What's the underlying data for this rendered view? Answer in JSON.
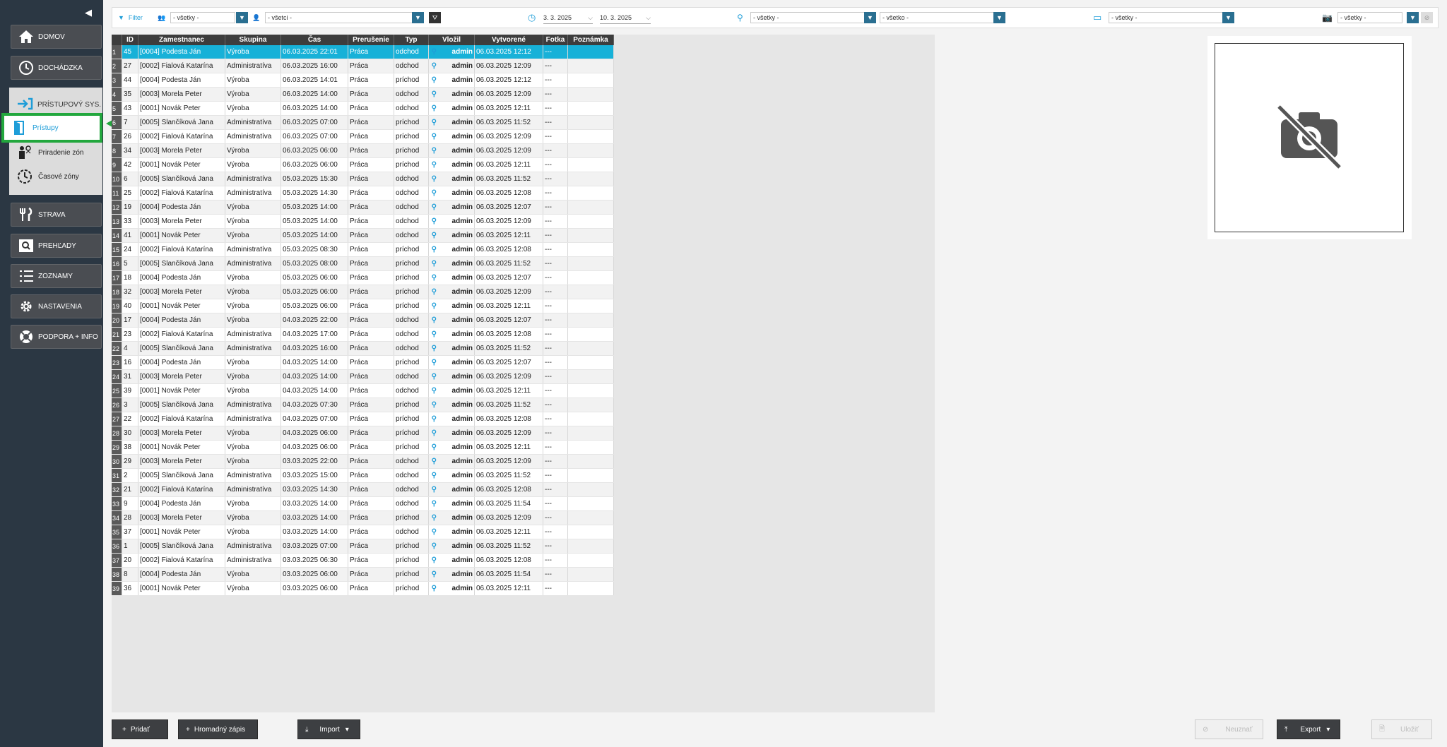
{
  "sidebar": {
    "collapse_icon": "triangle-left",
    "nav": [
      {
        "id": "domov",
        "label": "DOMOV",
        "icon": "home-icon"
      },
      {
        "id": "dochadzka",
        "label": "DOCHÁDZKA",
        "icon": "clock-icon"
      },
      {
        "id": "strava",
        "label": "STRAVA",
        "icon": "cutlery-icon"
      },
      {
        "id": "prehlady",
        "label": "PREHĽADY",
        "icon": "search-icon"
      },
      {
        "id": "zoznamy",
        "label": "ZOZNAMY",
        "icon": "list-icon"
      },
      {
        "id": "nastavenia",
        "label": "NASTAVENIA",
        "icon": "gear-icon"
      },
      {
        "id": "podpora",
        "label": "PODPORA + INFO",
        "icon": "lifebuoy-icon"
      }
    ],
    "access": {
      "label": "PRÍSTUPOVÝ SYS.",
      "items": [
        {
          "label": "Prístupy",
          "icon": "door-icon",
          "active": true
        },
        {
          "label": "Priradenie zón",
          "icon": "people-icon"
        },
        {
          "label": "Časové zóny",
          "icon": "clock-zone-icon"
        }
      ]
    }
  },
  "toolbar": {
    "filter_label": "Filter",
    "group_value": "- všetky -",
    "employee_value": "- všetci -",
    "date_from": "3. 3. 2025",
    "date_to": "10. 3. 2025",
    "location_value": "- všetky -",
    "location2_value": "- všetko -",
    "terminal_value": "- všetky -",
    "photo_value": "- všetky -"
  },
  "table": {
    "columns": [
      "ID",
      "Zamestnanec",
      "Skupina",
      "Čas",
      "Prerušenie",
      "Typ",
      "Vložil",
      "Vytvorené",
      "Fotka",
      "Poznámka"
    ],
    "rows": [
      [
        "45",
        "[0004] Podesta Ján",
        "Výroba",
        "06.03.2025 22:01",
        "Práca",
        "odchod",
        "admin",
        "06.03.2025 12:12",
        "---",
        ""
      ],
      [
        "27",
        "[0002] Fialová Katarína",
        "Administratíva",
        "06.03.2025 16:00",
        "Práca",
        "odchod",
        "admin",
        "06.03.2025 12:09",
        "---",
        ""
      ],
      [
        "44",
        "[0004] Podesta Ján",
        "Výroba",
        "06.03.2025 14:01",
        "Práca",
        "príchod",
        "admin",
        "06.03.2025 12:12",
        "---",
        ""
      ],
      [
        "35",
        "[0003] Morela Peter",
        "Výroba",
        "06.03.2025 14:00",
        "Práca",
        "odchod",
        "admin",
        "06.03.2025 12:09",
        "---",
        ""
      ],
      [
        "43",
        "[0001] Novák Peter",
        "Výroba",
        "06.03.2025 14:00",
        "Práca",
        "odchod",
        "admin",
        "06.03.2025 12:11",
        "---",
        ""
      ],
      [
        "7",
        "[0005] Slančíková Jana",
        "Administratíva",
        "06.03.2025 07:00",
        "Práca",
        "príchod",
        "admin",
        "06.03.2025 11:52",
        "---",
        ""
      ],
      [
        "26",
        "[0002] Fialová Katarína",
        "Administratíva",
        "06.03.2025 07:00",
        "Práca",
        "príchod",
        "admin",
        "06.03.2025 12:09",
        "---",
        ""
      ],
      [
        "34",
        "[0003] Morela Peter",
        "Výroba",
        "06.03.2025 06:00",
        "Práca",
        "príchod",
        "admin",
        "06.03.2025 12:09",
        "---",
        ""
      ],
      [
        "42",
        "[0001] Novák Peter",
        "Výroba",
        "06.03.2025 06:00",
        "Práca",
        "príchod",
        "admin",
        "06.03.2025 12:11",
        "---",
        ""
      ],
      [
        "6",
        "[0005] Slančíková Jana",
        "Administratíva",
        "05.03.2025 15:30",
        "Práca",
        "odchod",
        "admin",
        "06.03.2025 11:52",
        "---",
        ""
      ],
      [
        "25",
        "[0002] Fialová Katarína",
        "Administratíva",
        "05.03.2025 14:30",
        "Práca",
        "odchod",
        "admin",
        "06.03.2025 12:08",
        "---",
        ""
      ],
      [
        "19",
        "[0004] Podesta Ján",
        "Výroba",
        "05.03.2025 14:00",
        "Práca",
        "odchod",
        "admin",
        "06.03.2025 12:07",
        "---",
        ""
      ],
      [
        "33",
        "[0003] Morela Peter",
        "Výroba",
        "05.03.2025 14:00",
        "Práca",
        "odchod",
        "admin",
        "06.03.2025 12:09",
        "---",
        ""
      ],
      [
        "41",
        "[0001] Novák Peter",
        "Výroba",
        "05.03.2025 14:00",
        "Práca",
        "odchod",
        "admin",
        "06.03.2025 12:11",
        "---",
        ""
      ],
      [
        "24",
        "[0002] Fialová Katarína",
        "Administratíva",
        "05.03.2025 08:30",
        "Práca",
        "príchod",
        "admin",
        "06.03.2025 12:08",
        "---",
        ""
      ],
      [
        "5",
        "[0005] Slančíková Jana",
        "Administratíva",
        "05.03.2025 08:00",
        "Práca",
        "príchod",
        "admin",
        "06.03.2025 11:52",
        "---",
        ""
      ],
      [
        "18",
        "[0004] Podesta Ján",
        "Výroba",
        "05.03.2025 06:00",
        "Práca",
        "príchod",
        "admin",
        "06.03.2025 12:07",
        "---",
        ""
      ],
      [
        "32",
        "[0003] Morela Peter",
        "Výroba",
        "05.03.2025 06:00",
        "Práca",
        "príchod",
        "admin",
        "06.03.2025 12:09",
        "---",
        ""
      ],
      [
        "40",
        "[0001] Novák Peter",
        "Výroba",
        "05.03.2025 06:00",
        "Práca",
        "príchod",
        "admin",
        "06.03.2025 12:11",
        "---",
        ""
      ],
      [
        "17",
        "[0004] Podesta Ján",
        "Výroba",
        "04.03.2025 22:00",
        "Práca",
        "odchod",
        "admin",
        "06.03.2025 12:07",
        "---",
        ""
      ],
      [
        "23",
        "[0002] Fialová Katarína",
        "Administratíva",
        "04.03.2025 17:00",
        "Práca",
        "odchod",
        "admin",
        "06.03.2025 12:08",
        "---",
        ""
      ],
      [
        "4",
        "[0005] Slančíková Jana",
        "Administratíva",
        "04.03.2025 16:00",
        "Práca",
        "odchod",
        "admin",
        "06.03.2025 11:52",
        "---",
        ""
      ],
      [
        "16",
        "[0004] Podesta Ján",
        "Výroba",
        "04.03.2025 14:00",
        "Práca",
        "príchod",
        "admin",
        "06.03.2025 12:07",
        "---",
        ""
      ],
      [
        "31",
        "[0003] Morela Peter",
        "Výroba",
        "04.03.2025 14:00",
        "Práca",
        "odchod",
        "admin",
        "06.03.2025 12:09",
        "---",
        ""
      ],
      [
        "39",
        "[0001] Novák Peter",
        "Výroba",
        "04.03.2025 14:00",
        "Práca",
        "odchod",
        "admin",
        "06.03.2025 12:11",
        "---",
        ""
      ],
      [
        "3",
        "[0005] Slančíková Jana",
        "Administratíva",
        "04.03.2025 07:30",
        "Práca",
        "príchod",
        "admin",
        "06.03.2025 11:52",
        "---",
        ""
      ],
      [
        "22",
        "[0002] Fialová Katarína",
        "Administratíva",
        "04.03.2025 07:00",
        "Práca",
        "príchod",
        "admin",
        "06.03.2025 12:08",
        "---",
        ""
      ],
      [
        "30",
        "[0003] Morela Peter",
        "Výroba",
        "04.03.2025 06:00",
        "Práca",
        "príchod",
        "admin",
        "06.03.2025 12:09",
        "---",
        ""
      ],
      [
        "38",
        "[0001] Novák Peter",
        "Výroba",
        "04.03.2025 06:00",
        "Práca",
        "príchod",
        "admin",
        "06.03.2025 12:11",
        "---",
        ""
      ],
      [
        "29",
        "[0003] Morela Peter",
        "Výroba",
        "03.03.2025 22:00",
        "Práca",
        "odchod",
        "admin",
        "06.03.2025 12:09",
        "---",
        ""
      ],
      [
        "2",
        "[0005] Slančíková Jana",
        "Administratíva",
        "03.03.2025 15:00",
        "Práca",
        "odchod",
        "admin",
        "06.03.2025 11:52",
        "---",
        ""
      ],
      [
        "21",
        "[0002] Fialová Katarína",
        "Administratíva",
        "03.03.2025 14:30",
        "Práca",
        "odchod",
        "admin",
        "06.03.2025 12:08",
        "---",
        ""
      ],
      [
        "9",
        "[0004] Podesta Ján",
        "Výroba",
        "03.03.2025 14:00",
        "Práca",
        "odchod",
        "admin",
        "06.03.2025 11:54",
        "---",
        ""
      ],
      [
        "28",
        "[0003] Morela Peter",
        "Výroba",
        "03.03.2025 14:00",
        "Práca",
        "príchod",
        "admin",
        "06.03.2025 12:09",
        "---",
        ""
      ],
      [
        "37",
        "[0001] Novák Peter",
        "Výroba",
        "03.03.2025 14:00",
        "Práca",
        "odchod",
        "admin",
        "06.03.2025 12:11",
        "---",
        ""
      ],
      [
        "1",
        "[0005] Slančíková Jana",
        "Administratíva",
        "03.03.2025 07:00",
        "Práca",
        "príchod",
        "admin",
        "06.03.2025 11:52",
        "---",
        ""
      ],
      [
        "20",
        "[0002] Fialová Katarína",
        "Administratíva",
        "03.03.2025 06:30",
        "Práca",
        "príchod",
        "admin",
        "06.03.2025 12:08",
        "---",
        ""
      ],
      [
        "8",
        "[0004] Podesta Ján",
        "Výroba",
        "03.03.2025 06:00",
        "Práca",
        "príchod",
        "admin",
        "06.03.2025 11:54",
        "---",
        ""
      ],
      [
        "36",
        "[0001] Novák Peter",
        "Výroba",
        "03.03.2025 06:00",
        "Práca",
        "príchod",
        "admin",
        "06.03.2025 12:11",
        "---",
        ""
      ]
    ],
    "selected_row": 0
  },
  "photo": {
    "icon": "no-camera-icon"
  },
  "footer": {
    "add_label": "Pridať",
    "bulk_label": "Hromadný zápis",
    "import_label": "Import",
    "cancel_label": "Neuznať",
    "export_label": "Export",
    "save_label": "Uložiť"
  },
  "colors": {
    "accent": "#17b1d8",
    "highlight": "#22a73d",
    "sidebar": "#2b3743"
  }
}
